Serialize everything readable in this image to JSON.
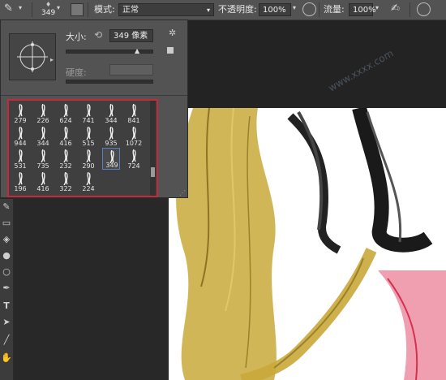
{
  "options_bar": {
    "brush_size": "349",
    "mode_label": "模式:",
    "mode_value": "正常",
    "opacity_label": "不透明度:",
    "opacity_value": "100%",
    "flow_label": "流量:",
    "flow_value": "100%"
  },
  "brush_panel": {
    "size_label": "大小:",
    "size_value": "349 像素",
    "hardness_label": "硬度:",
    "brushes": [
      "279",
      "226",
      "624",
      "741",
      "344",
      "841",
      "944",
      "344",
      "416",
      "515",
      "935",
      "1072",
      "531",
      "735",
      "232",
      "290",
      "349",
      "724",
      "196",
      "416",
      "322",
      "224"
    ],
    "selected_brush": "349"
  },
  "colors": {
    "selection_border": "#c42a3c",
    "hair_gold": "#c9a93a",
    "hair_pink": "#e2506e"
  }
}
